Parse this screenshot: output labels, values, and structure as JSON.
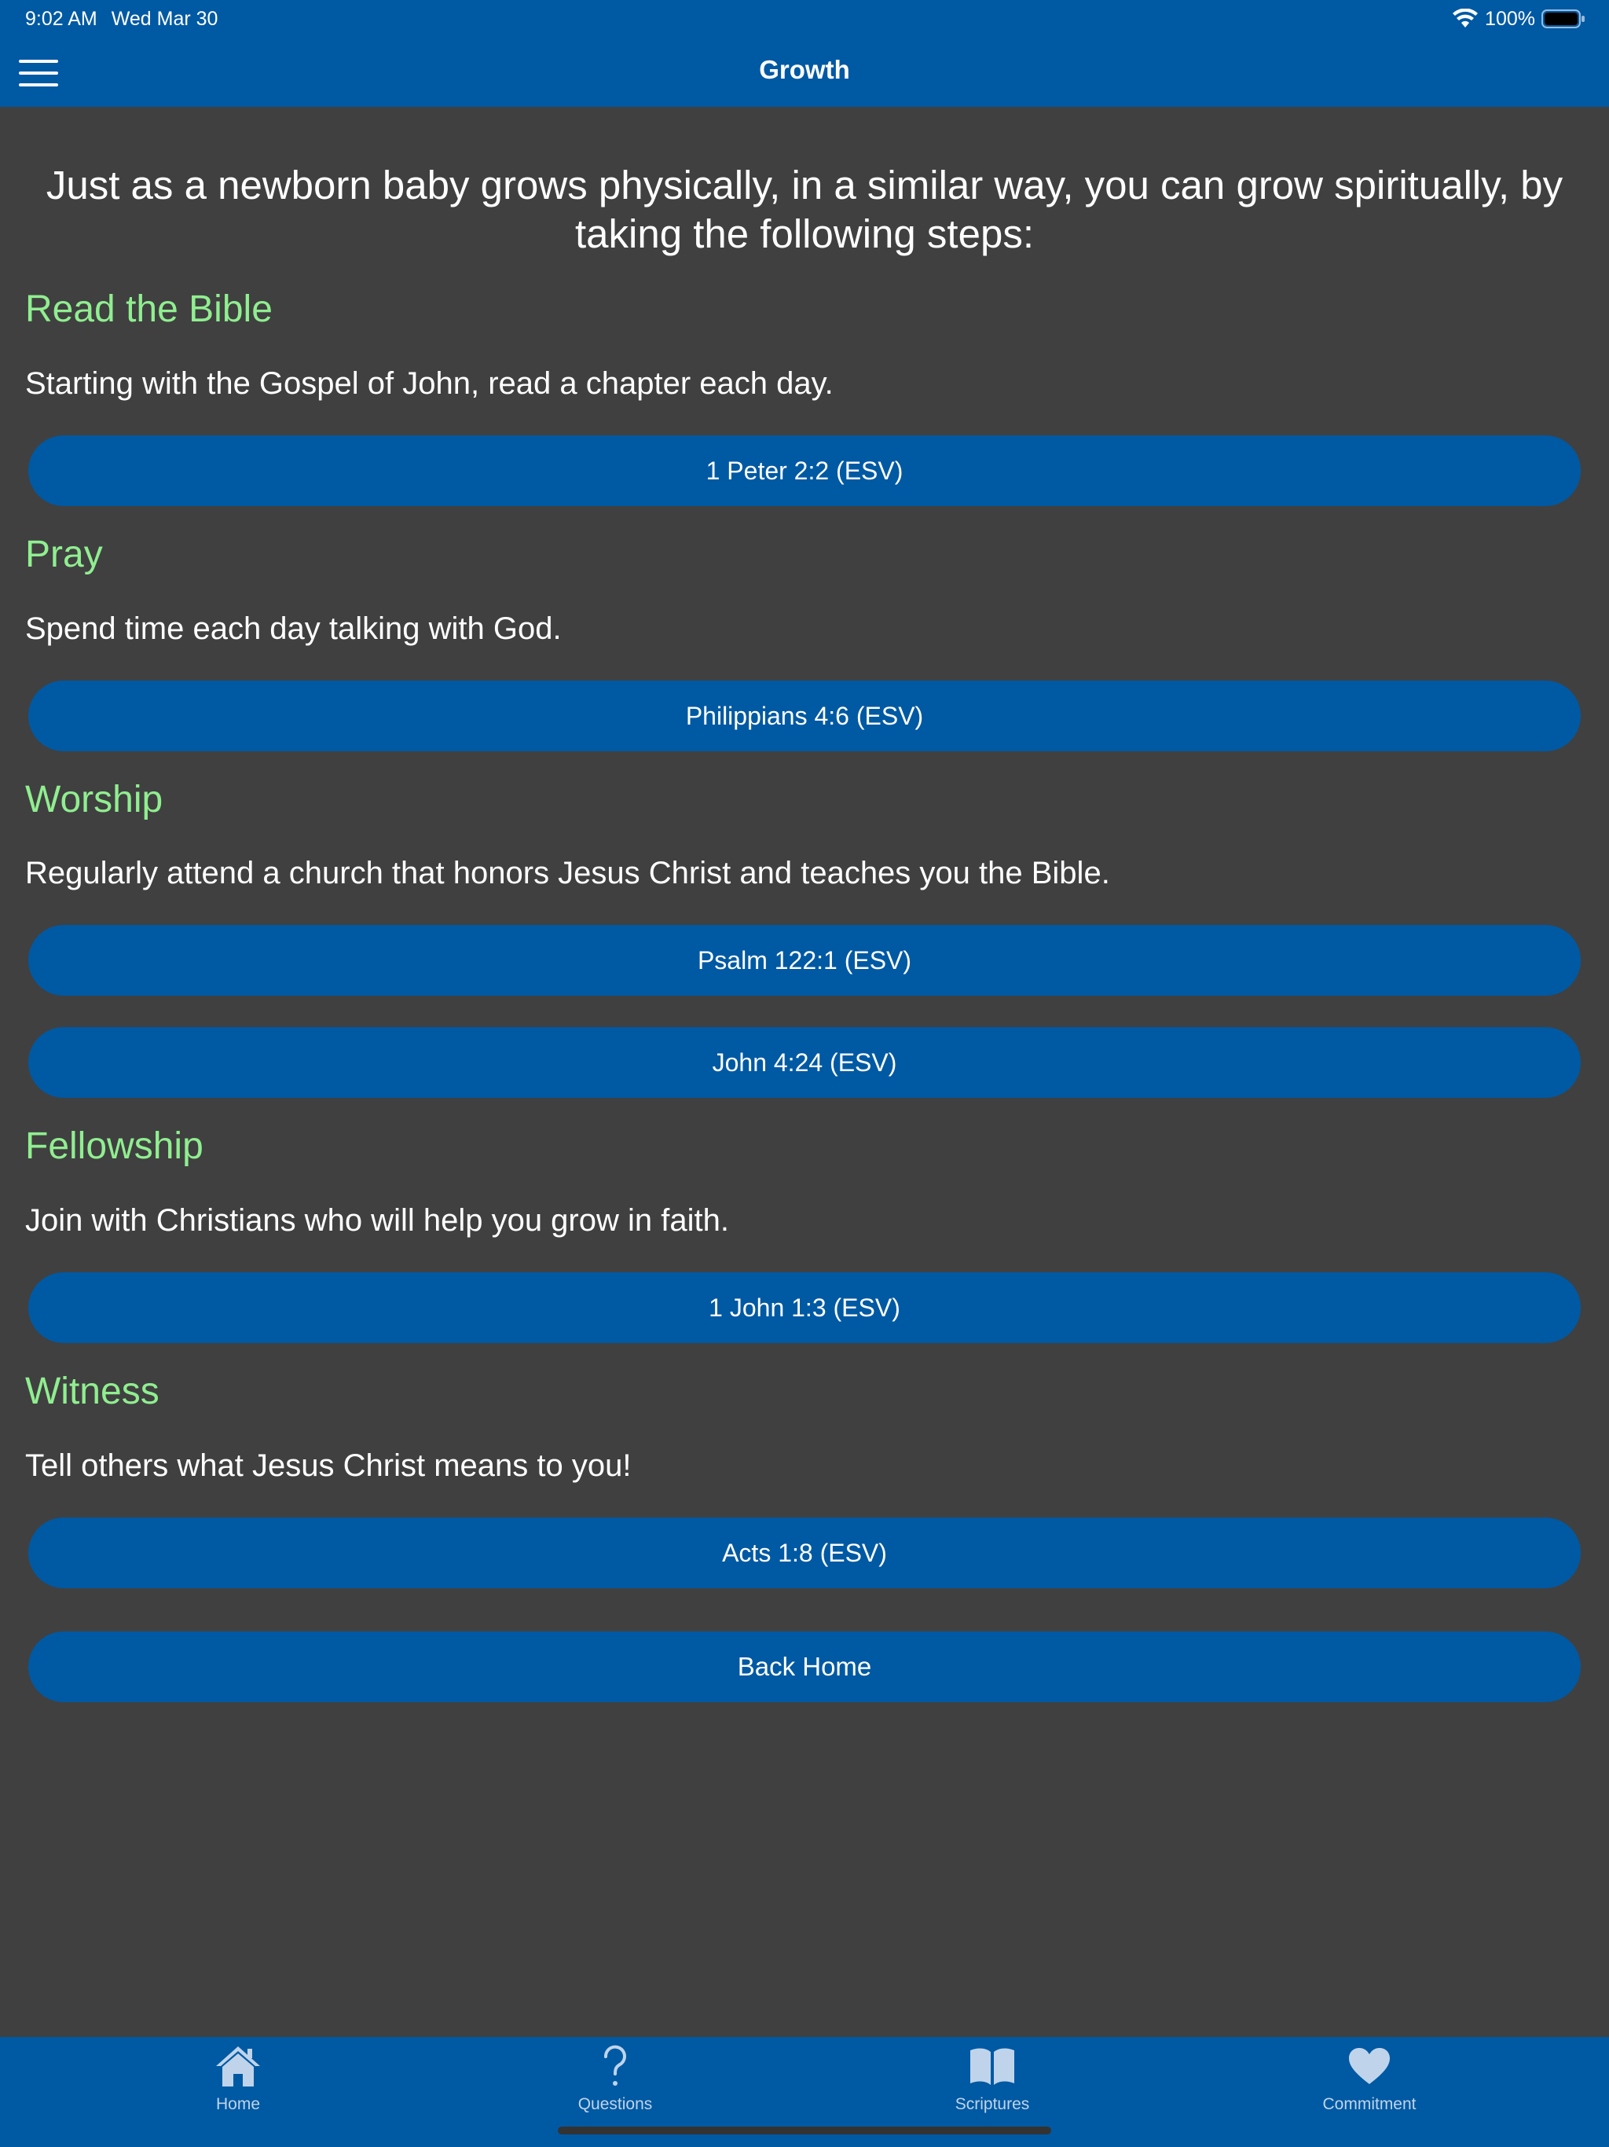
{
  "status": {
    "time": "9:02 AM",
    "date": "Wed Mar 30",
    "battery": "100%"
  },
  "nav": {
    "title": "Growth"
  },
  "intro": "Just as a newborn baby grows physically, in a similar way, you can grow spiritually, by taking the following steps:",
  "sections": [
    {
      "heading": "Read the Bible",
      "text": "Starting with the Gospel of John, read a chapter each day.",
      "buttons": [
        "1 Peter 2:2 (ESV)"
      ]
    },
    {
      "heading": "Pray",
      "text": "Spend time each day talking with God.",
      "buttons": [
        "Philippians 4:6 (ESV)"
      ]
    },
    {
      "heading": "Worship",
      "text": "Regularly attend a church that honors Jesus Christ and teaches you the Bible.",
      "buttons": [
        "Psalm 122:1 (ESV)",
        "John 4:24 (ESV)"
      ]
    },
    {
      "heading": "Fellowship",
      "text": "Join with Christians who will help you grow in faith.",
      "buttons": [
        "1 John 1:3 (ESV)"
      ]
    },
    {
      "heading": "Witness",
      "text": "Tell others what Jesus Christ means to you!",
      "buttons": [
        "Acts 1:8 (ESV)"
      ]
    }
  ],
  "back_home_label": "Back Home",
  "tabs": [
    {
      "label": "Home",
      "icon": "house-icon"
    },
    {
      "label": "Questions",
      "icon": "question-mark-icon"
    },
    {
      "label": "Scriptures",
      "icon": "book-icon"
    },
    {
      "label": "Commitment",
      "icon": "heart-icon"
    }
  ],
  "colors": {
    "bar_blue": "#0059A3",
    "background": "#404040",
    "heading_green": "#90EE90",
    "tab_label": "#BFD4EA"
  }
}
